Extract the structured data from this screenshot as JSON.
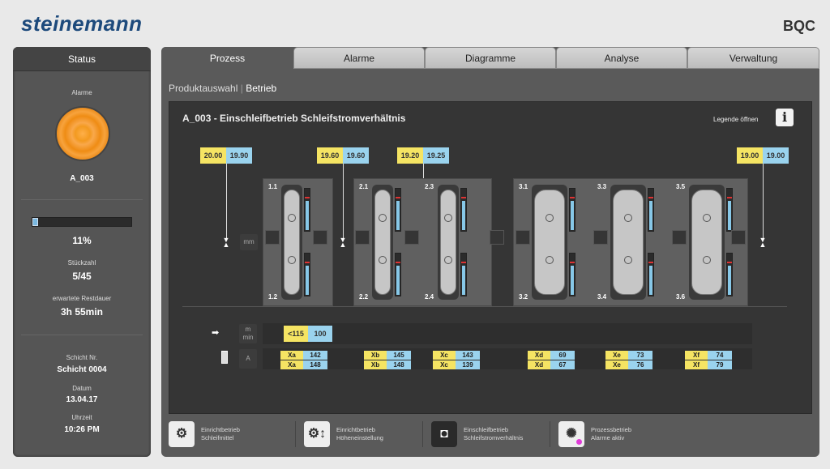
{
  "brand": "steinemann",
  "machine": "BQC",
  "sidebar": {
    "title": "Status",
    "alarm_label": "Alarme",
    "alarm_code": "A_003",
    "progress_pct": 11,
    "progress_text": "11%",
    "count_label": "Stückzahl",
    "count_value": "5/45",
    "remaining_label": "erwartete Restdauer",
    "remaining_value": "3h 55min",
    "shift_label": "Schicht Nr.",
    "shift_value": "Schicht 0004",
    "date_label": "Datum",
    "date_value": "13.04.17",
    "time_label": "Uhrzeit",
    "time_value": "10:26 PM"
  },
  "tabs": [
    "Prozess",
    "Alarme",
    "Diagramme",
    "Analyse",
    "Verwaltung"
  ],
  "breadcrumb": {
    "first": "Produktauswahl",
    "second": "Betrieb"
  },
  "panel": {
    "title": "A_003 - Einschleifbetrieb Schleifstromverhältnis",
    "legend_label": "Legende öffnen",
    "info_icon": "i"
  },
  "gauges": [
    {
      "yellow": "20.00",
      "blue": "19.90"
    },
    {
      "yellow": "19.60",
      "blue": "19.60"
    },
    {
      "yellow": "19.20",
      "blue": "19.25"
    },
    {
      "yellow": "19.00",
      "blue": "19.00"
    }
  ],
  "unit_mm": "mm",
  "units": {
    "speed_top": "m",
    "speed_bottom": "min",
    "amp": "A"
  },
  "speed": {
    "yellow": "<115",
    "blue": "100"
  },
  "heads_top": [
    "1.1",
    "2.1",
    "2.3",
    "3.1",
    "3.3",
    "3.5"
  ],
  "heads_bottom": [
    "1.2",
    "2.2",
    "2.4",
    "3.2",
    "3.4",
    "3.6"
  ],
  "amps": [
    {
      "l1": "Xa",
      "v1": "142",
      "l2": "Xa",
      "v2": "148"
    },
    {
      "l1": "Xb",
      "v1": "145",
      "l2": "Xb",
      "v2": "148"
    },
    {
      "l1": "Xc",
      "v1": "143",
      "l2": "Xc",
      "v2": "139"
    },
    {
      "l1": "Xd",
      "v1": "69",
      "l2": "Xd",
      "v2": "67"
    },
    {
      "l1": "Xe",
      "v1": "73",
      "l2": "Xe",
      "v2": "76"
    },
    {
      "l1": "Xf",
      "v1": "74",
      "l2": "Xf",
      "v2": "79"
    }
  ],
  "footer": [
    {
      "line1": "Einrichtbetrieb",
      "line2": "Schleifmittel",
      "icon": "gear-sensor-icon"
    },
    {
      "line1": "Einrichtbetrieb",
      "line2": "Höheneinstellung",
      "icon": "gear-updown-icon"
    },
    {
      "line1": "Einschleifbetrieb",
      "line2": "Schleifstromverhältnis",
      "icon": "grinding-icon"
    },
    {
      "line1": "Prozessbetrieb",
      "line2": "Alarme aktiv",
      "icon": "process-spinner-icon"
    }
  ]
}
